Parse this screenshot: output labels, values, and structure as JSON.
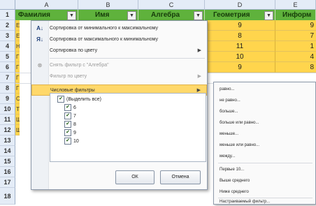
{
  "columns": [
    "A",
    "B",
    "C",
    "D",
    "E"
  ],
  "row_numbers": [
    "1",
    "2",
    "3",
    "4",
    "5",
    "6",
    "7",
    "8",
    "9",
    "10",
    "11",
    "12",
    "13",
    "14",
    "15",
    "16",
    "17",
    "18"
  ],
  "headers": {
    "familiya": "Фамилия",
    "imya": "Имя",
    "algebra": "Алгебра",
    "geometriya": "Геометрия",
    "informatika": "Информ"
  },
  "column_d_values": [
    "9",
    "8",
    "11",
    "10",
    "9"
  ],
  "column_e_values": [
    "9",
    "7",
    "1",
    "4",
    "8"
  ],
  "column_a_fragments": [
    "Е",
    "Е",
    "Н",
    "Г",
    "Г",
    "Г",
    "Г",
    "С",
    "Т",
    "Ш",
    "Ш"
  ],
  "filter_menu": {
    "sort_asc": "Сортировка от минимального к максимальному",
    "sort_desc": "Сортировка от максимального к минимальному",
    "sort_by_color": "Сортировка по цвету",
    "clear_filter": "Снять фильтр с \"Алгебра\"",
    "filter_by_color": "Фильтр по цвету",
    "number_filters": "Числовые фильтры",
    "checkboxes": [
      {
        "label": "(Выделить все)",
        "checked": true
      },
      {
        "label": "6",
        "checked": true
      },
      {
        "label": "7",
        "checked": true
      },
      {
        "label": "8",
        "checked": true
      },
      {
        "label": "9",
        "checked": true
      },
      {
        "label": "10",
        "checked": true
      }
    ],
    "ok": "ОК",
    "cancel": "Отмена"
  },
  "number_filters_submenu": [
    "равно...",
    "не равно...",
    "больше...",
    "больше или равно...",
    "меньше...",
    "меньше или равно...",
    "между...",
    "Первые 10...",
    "Выше среднего",
    "Ниже среднего",
    "Настраиваемый фильтр..."
  ],
  "colors": {
    "header_green": "#5fb23c",
    "highlight_yellow": "#ffd54d",
    "menu_hover": "#ffd86a",
    "grid_header": "#e4ecf7"
  }
}
